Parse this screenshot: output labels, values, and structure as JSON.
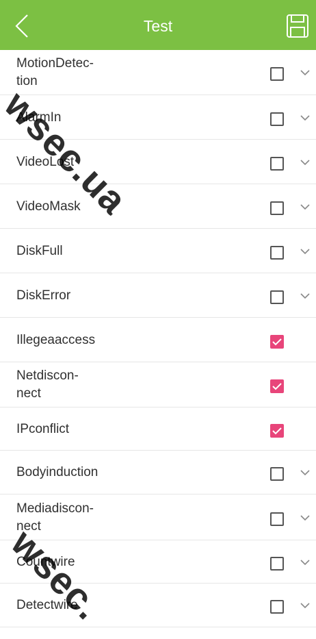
{
  "header": {
    "title": "Test",
    "back_icon": "chevron-left-icon",
    "save_icon": "floppy-disk-icon",
    "background": "#7cc043"
  },
  "items": [
    {
      "label_lines": [
        "MotionDetec-",
        "tion"
      ],
      "checked": false,
      "expandable": true
    },
    {
      "label_lines": [
        "AlarmIn"
      ],
      "checked": false,
      "expandable": true
    },
    {
      "label_lines": [
        "VideoLost"
      ],
      "checked": false,
      "expandable": true
    },
    {
      "label_lines": [
        "VideoMask"
      ],
      "checked": false,
      "expandable": true
    },
    {
      "label_lines": [
        "DiskFull"
      ],
      "checked": false,
      "expandable": true
    },
    {
      "label_lines": [
        "DiskError"
      ],
      "checked": false,
      "expandable": true
    },
    {
      "label_lines": [
        "Illegeaaccess"
      ],
      "checked": true,
      "expandable": false
    },
    {
      "label_lines": [
        "Netdiscon-",
        "nect"
      ],
      "checked": true,
      "expandable": false
    },
    {
      "label_lines": [
        "IPconflict"
      ],
      "checked": true,
      "expandable": false
    },
    {
      "label_lines": [
        "Bodyinduction"
      ],
      "checked": false,
      "expandable": true
    },
    {
      "label_lines": [
        "Mediadiscon-",
        "nect"
      ],
      "checked": false,
      "expandable": true
    },
    {
      "label_lines": [
        "Countwire"
      ],
      "checked": false,
      "expandable": true
    },
    {
      "label_lines": [
        "Detectwire"
      ],
      "checked": false,
      "expandable": true
    }
  ],
  "colors": {
    "checked": "#e8457a",
    "divider": "#e6e6e6"
  },
  "watermark": {
    "text_top": "wsec.ua",
    "text_bottom": "wsec."
  }
}
